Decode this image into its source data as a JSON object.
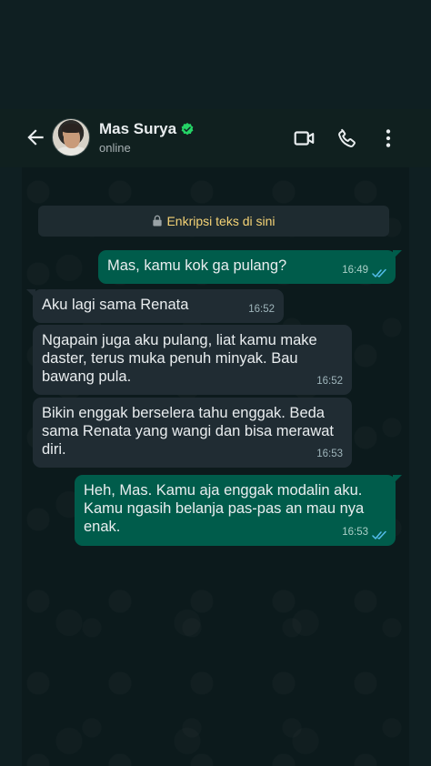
{
  "contact": {
    "name": "Mas Surya",
    "status": "online"
  },
  "encryption_notice": "Enkripsi teks di sini",
  "messages": [
    {
      "direction": "out",
      "text": "Mas, kamu kok ga pulang?",
      "time": "16:49",
      "read": true
    },
    {
      "direction": "in",
      "text": "Aku lagi sama Renata",
      "time": "16:52"
    },
    {
      "direction": "in",
      "text": "Ngapain juga aku pulang, liat kamu make daster, terus muka penuh minyak. Bau bawang pula.",
      "time": "16:52"
    },
    {
      "direction": "in",
      "text": "Bikin enggak berselera tahu enggak. Beda sama Renata yang wangi dan bisa merawat diri.",
      "time": "16:53"
    },
    {
      "direction": "out",
      "text": "Heh, Mas. Kamu aja enggak modalin aku. Kamu ngasih belanja pas-pas an mau nya enak.",
      "time": "16:53",
      "read": true
    }
  ],
  "colors": {
    "incoming_bubble": "#202c33",
    "outgoing_bubble": "#005c4b",
    "read_ticks": "#53bdeb",
    "verified_badge": "#25d366"
  }
}
